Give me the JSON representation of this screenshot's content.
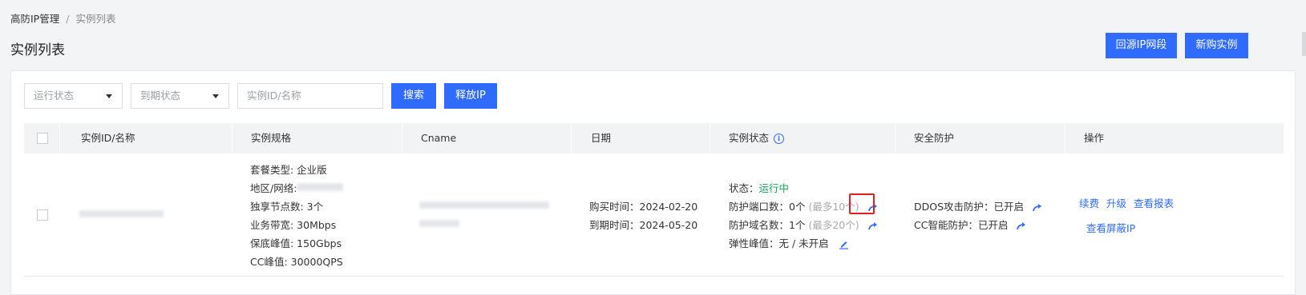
{
  "breadcrumb": {
    "parent": "高防IP管理",
    "separator": "/",
    "current": "实例列表"
  },
  "page_title": "实例列表",
  "header_buttons": {
    "origin_ip": "回源IP网段",
    "buy_new": "新购实例"
  },
  "filters": {
    "run_status_placeholder": "运行状态",
    "expire_status_placeholder": "到期状态",
    "search_placeholder": "实例ID/名称",
    "search_button": "搜索",
    "release_ip_button": "释放IP"
  },
  "table": {
    "headers": {
      "id_name": "实例ID/名称",
      "spec": "实例规格",
      "cname": "Cname",
      "date": "日期",
      "status": "实例状态",
      "security": "安全防护",
      "actions": "操作"
    },
    "row": {
      "spec": {
        "package_type": "套餐类型: 企业版",
        "region": "地区/网络: ",
        "nodes": "独享节点数: 3个",
        "bandwidth": "业务带宽: 30Mbps",
        "guarantee_peak": "保底峰值: 150Gbps",
        "cc_peak": "CC峰值: 30000QPS"
      },
      "dates": {
        "purchase": "购买时间：2024-02-20",
        "expire": "到期时间：2024-05-20"
      },
      "status": {
        "state_label": "状态：",
        "state_value": "运行中",
        "ports_label": "防护端口数：",
        "ports_value": "0个",
        "ports_max": "(最多10个)",
        "domains_label": "防护域名数：",
        "domains_value": "1个",
        "domains_max": "(最多20个)",
        "elastic_label": "弹性峰值：",
        "elastic_value": "无 / 未开启"
      },
      "security": {
        "ddos_label": "DDOS攻击防护：",
        "ddos_value": "已开启",
        "cc_label": "CC智能防护：",
        "cc_value": "已开启"
      },
      "actions": {
        "renew": "续费",
        "upgrade": "升级",
        "view_report": "查看报表",
        "view_blocked_ip": "查看屏蔽IP"
      }
    }
  },
  "colors": {
    "primary": "#2f6bff",
    "running": "#19a35b",
    "highlight": "#e02020"
  }
}
